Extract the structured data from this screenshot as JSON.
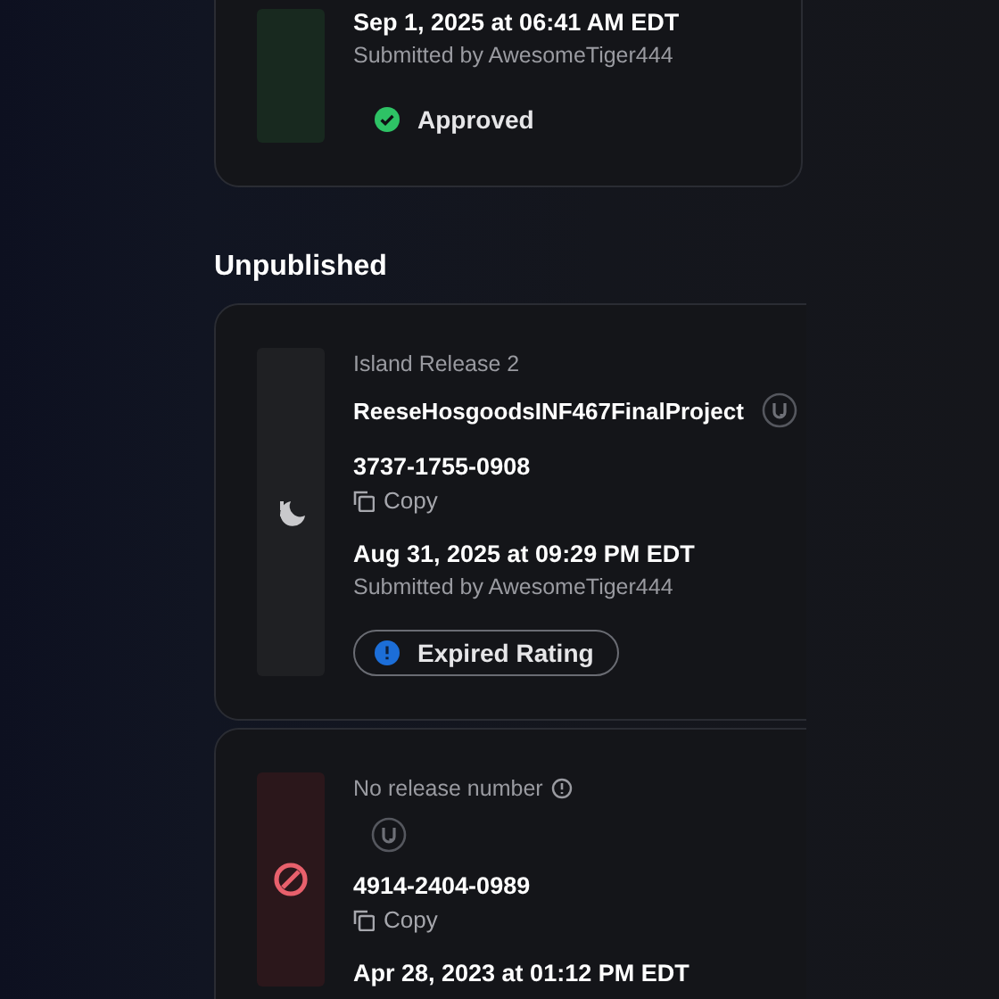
{
  "published_cards": [
    {
      "kind": "approved",
      "date": "Sep 1, 2025 at 06:41 AM EDT",
      "submitter": "Submitted by AwesomeTiger444",
      "status": {
        "kind": "approved",
        "label": "Approved"
      }
    }
  ],
  "section_title": "Unpublished",
  "unpublished_cards": [
    {
      "kind": "expired",
      "release": "Island Release 2",
      "release_info": false,
      "title": "ReeseHosgoodsINF467FinalProject",
      "code": "3737-1755-0908",
      "copy_label": "Copy",
      "date": "Aug 31, 2025 at 09:29 PM EDT",
      "submitter": "Submitted by AwesomeTiger444",
      "status": {
        "kind": "expired",
        "label": "Expired Rating"
      }
    },
    {
      "kind": "banned",
      "release": "No release number",
      "release_info": true,
      "code": "4914-2404-0989",
      "copy_label": "Copy",
      "date": "Apr 28, 2023 at 01:12 PM EDT"
    }
  ]
}
